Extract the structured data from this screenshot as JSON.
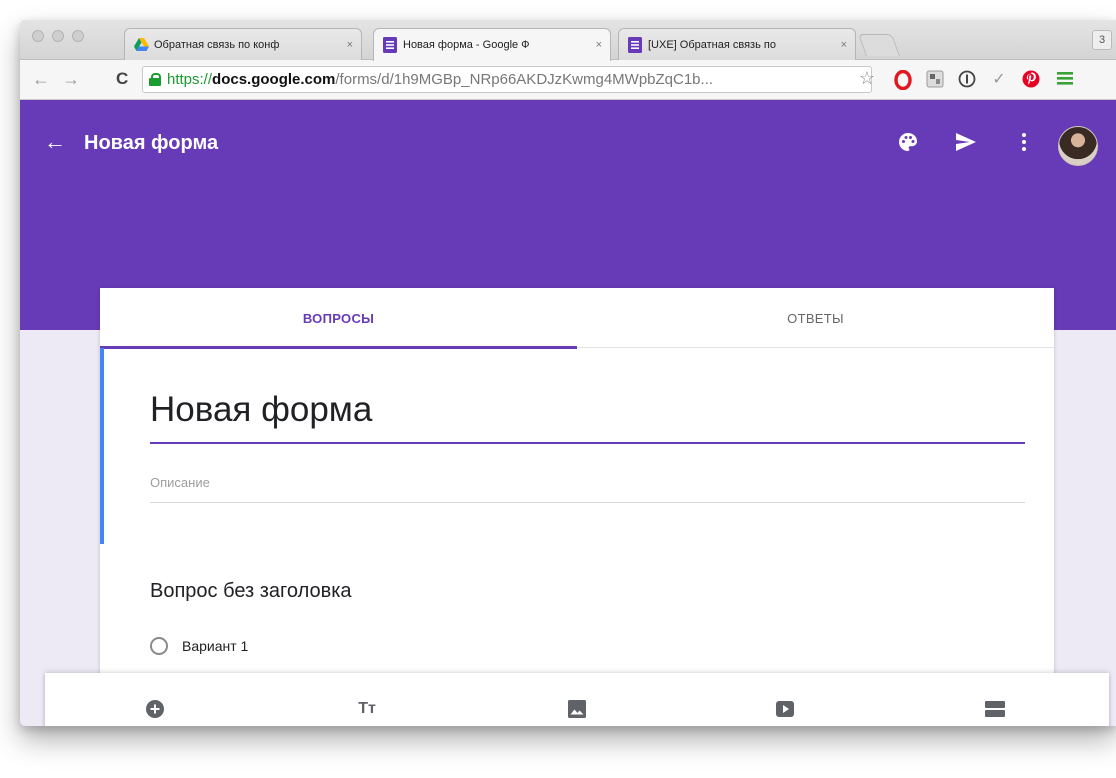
{
  "browser": {
    "tabs": [
      {
        "title": "Обратная связь по конф",
        "icon": "google-drive-icon",
        "active": false
      },
      {
        "title": "Новая форма - Google Ф",
        "icon": "google-forms-icon",
        "active": true
      },
      {
        "title": "[UXE] Обратная связь по",
        "icon": "google-forms-icon",
        "active": false
      }
    ],
    "close_glyph": "×",
    "extra_glyph": "3",
    "address": {
      "scheme": "https://",
      "host": "docs.google.com",
      "path": "/forms/d/1h9MGBp_NRp66AKDJzKwmg4MWpbZqC1b..."
    },
    "nav": {
      "back": "←",
      "forward": "→",
      "reload": "C"
    },
    "extensions": [
      "star-icon",
      "opera-icon",
      "translate-icon",
      "onepassword-icon",
      "check-icon",
      "pinterest-icon",
      "menu-icon"
    ],
    "extension_glyphs": {
      "star": "☆",
      "check": "✓"
    }
  },
  "header": {
    "back": "←",
    "title": "Новая форма",
    "color": "#673ab7"
  },
  "form": {
    "tabs": {
      "questions": "ВОПРОСЫ",
      "responses": "ОТВЕТЫ"
    },
    "title": "Новая форма",
    "description_placeholder": "Описание",
    "question": {
      "title": "Вопрос без заголовка",
      "options": [
        "Вариант 1"
      ]
    }
  },
  "bottom_toolbar": [
    "add-question-icon",
    "title-text-icon",
    "image-icon",
    "video-icon",
    "section-icon"
  ],
  "bottom_toolbar_glyphs": {
    "title_text": "Tт"
  }
}
